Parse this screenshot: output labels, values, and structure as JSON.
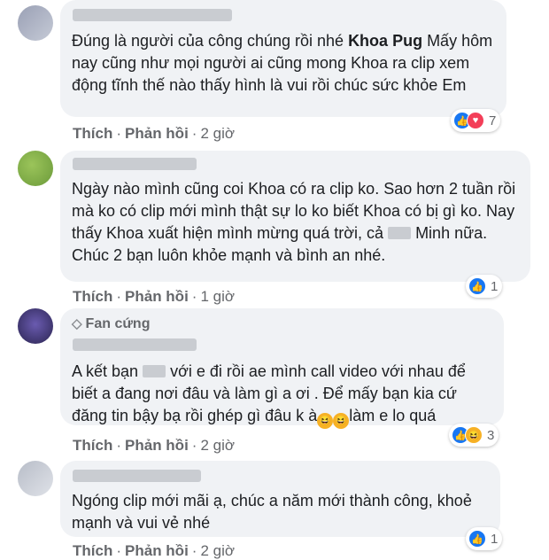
{
  "comments": [
    {
      "text_pre": "Đúng là người của công chúng rồi nhé ",
      "mention": "Khoa Pug",
      "text_post": " Mấy hôm nay cũng như mọi người ai cũng mong Khoa ra clip xem động tĩnh thế nào thấy hình là vui rồi chúc sức khỏe Em",
      "like": "Thích",
      "reply": "Phản hồi",
      "time": "2 giờ",
      "reaction_count": "7",
      "reactions": [
        "like",
        "love"
      ]
    },
    {
      "text_pre": "Ngày nào mình cũng coi Khoa có ra clip ko. Sao hơn 2 tuần rồi mà ko có clip mới mình thật sự lo ko biết Khoa có bị gì ko. Nay thấy Khoa xuất hiện mình mừng quá trời, cả",
      "text_post": " Minh nữa. Chúc 2 bạn luôn khỏe mạnh và bình an nhé.",
      "like": "Thích",
      "reply": "Phản hồi",
      "time": "1 giờ",
      "reaction_count": "1",
      "reactions": [
        "like"
      ]
    },
    {
      "badge": "Fan cứng",
      "text_pre": "A kết bạn",
      "text_post": " với e đi rồi ae mình call video với nhau để biết a đang nơi đâu và làm gì a ơi . Để mấy bạn kia cứ đăng tin bậy bạ rồi ghép gì đâu k à",
      "text_end": "làm e lo quá",
      "like": "Thích",
      "reply": "Phản hồi",
      "time": "2 giờ",
      "reaction_count": "3",
      "reactions": [
        "like",
        "haha"
      ]
    },
    {
      "text_pre": "Ngóng clip mới mãi ạ, chúc a năm mới thành công, khoẻ mạnh và vui vẻ nhé",
      "like": "Thích",
      "reply": "Phản hồi",
      "time": "2 giờ",
      "reaction_count": "1",
      "reactions": [
        "like"
      ]
    }
  ],
  "colors": {
    "bubble": "#f0f2f5",
    "meta": "#65676b",
    "like": "#1877f2",
    "love": "#f33e58",
    "haha": "#f7b125"
  },
  "icons": [
    "like-icon",
    "love-icon",
    "haha-icon",
    "diamond-icon",
    "laughing-emoji-icon"
  ]
}
